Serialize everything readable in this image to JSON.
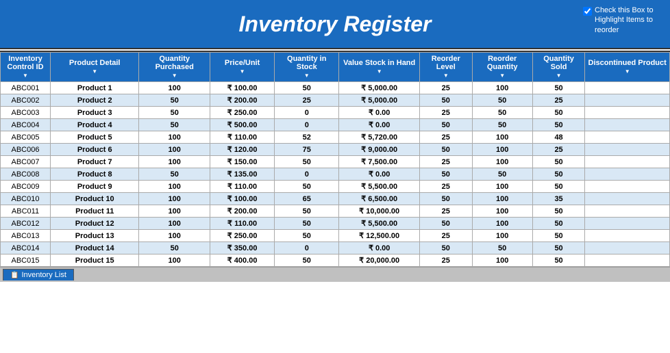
{
  "header": {
    "title": "Inventory Register",
    "checkbox_label": "Check this Box to Highlight Items to reorder",
    "checkbox_checked": true
  },
  "columns": [
    {
      "id": "inv-control-id",
      "label": "Inventory Control ID",
      "class": "col-id"
    },
    {
      "id": "product-detail",
      "label": "Product Detail",
      "class": "col-product"
    },
    {
      "id": "qty-purchased",
      "label": "Quantity Purchased",
      "class": "col-qty-purchased"
    },
    {
      "id": "price-unit",
      "label": "Price/Unit",
      "class": "col-price"
    },
    {
      "id": "qty-stock",
      "label": "Quantity in Stock",
      "class": "col-qty-stock"
    },
    {
      "id": "value-stock",
      "label": "Value Stock in Hand",
      "class": "col-value-stock"
    },
    {
      "id": "reorder-level",
      "label": "Reorder Level",
      "class": "col-reorder-level"
    },
    {
      "id": "reorder-qty",
      "label": "Reorder Quantity",
      "class": "col-reorder-qty"
    },
    {
      "id": "qty-sold",
      "label": "Quantity Sold",
      "class": "col-qty-sold"
    },
    {
      "id": "discontinued",
      "label": "Discontinued Product",
      "class": "col-discontinued"
    }
  ],
  "rows": [
    {
      "id": "ABC001",
      "product": "Product 1",
      "qty_purchased": 100,
      "price": "₹ 100.00",
      "qty_stock": 50,
      "value_stock": "₹ 5,000.00",
      "reorder_level": 25,
      "reorder_qty": 100,
      "qty_sold": 50,
      "discontinued": ""
    },
    {
      "id": "ABC002",
      "product": "Product 2",
      "qty_purchased": 50,
      "price": "₹ 200.00",
      "qty_stock": 25,
      "value_stock": "₹ 5,000.00",
      "reorder_level": 50,
      "reorder_qty": 50,
      "qty_sold": 25,
      "discontinued": ""
    },
    {
      "id": "ABC003",
      "product": "Product 3",
      "qty_purchased": 50,
      "price": "₹ 250.00",
      "qty_stock": 0,
      "value_stock": "₹ 0.00",
      "reorder_level": 25,
      "reorder_qty": 50,
      "qty_sold": 50,
      "discontinued": ""
    },
    {
      "id": "ABC004",
      "product": "Product 4",
      "qty_purchased": 50,
      "price": "₹ 500.00",
      "qty_stock": 0,
      "value_stock": "₹ 0.00",
      "reorder_level": 50,
      "reorder_qty": 50,
      "qty_sold": 50,
      "discontinued": ""
    },
    {
      "id": "ABC005",
      "product": "Product 5",
      "qty_purchased": 100,
      "price": "₹ 110.00",
      "qty_stock": 52,
      "value_stock": "₹ 5,720.00",
      "reorder_level": 25,
      "reorder_qty": 100,
      "qty_sold": 48,
      "discontinued": ""
    },
    {
      "id": "ABC006",
      "product": "Product 6",
      "qty_purchased": 100,
      "price": "₹ 120.00",
      "qty_stock": 75,
      "value_stock": "₹ 9,000.00",
      "reorder_level": 50,
      "reorder_qty": 100,
      "qty_sold": 25,
      "discontinued": ""
    },
    {
      "id": "ABC007",
      "product": "Product 7",
      "qty_purchased": 100,
      "price": "₹ 150.00",
      "qty_stock": 50,
      "value_stock": "₹ 7,500.00",
      "reorder_level": 25,
      "reorder_qty": 100,
      "qty_sold": 50,
      "discontinued": ""
    },
    {
      "id": "ABC008",
      "product": "Product 8",
      "qty_purchased": 50,
      "price": "₹ 135.00",
      "qty_stock": 0,
      "value_stock": "₹ 0.00",
      "reorder_level": 50,
      "reorder_qty": 50,
      "qty_sold": 50,
      "discontinued": ""
    },
    {
      "id": "ABC009",
      "product": "Product 9",
      "qty_purchased": 100,
      "price": "₹ 110.00",
      "qty_stock": 50,
      "value_stock": "₹ 5,500.00",
      "reorder_level": 25,
      "reorder_qty": 100,
      "qty_sold": 50,
      "discontinued": ""
    },
    {
      "id": "ABC010",
      "product": "Product 10",
      "qty_purchased": 100,
      "price": "₹ 100.00",
      "qty_stock": 65,
      "value_stock": "₹ 6,500.00",
      "reorder_level": 50,
      "reorder_qty": 100,
      "qty_sold": 35,
      "discontinued": ""
    },
    {
      "id": "ABC011",
      "product": "Product 11",
      "qty_purchased": 100,
      "price": "₹ 200.00",
      "qty_stock": 50,
      "value_stock": "₹ 10,000.00",
      "reorder_level": 25,
      "reorder_qty": 100,
      "qty_sold": 50,
      "discontinued": ""
    },
    {
      "id": "ABC012",
      "product": "Product 12",
      "qty_purchased": 100,
      "price": "₹ 110.00",
      "qty_stock": 50,
      "value_stock": "₹ 5,500.00",
      "reorder_level": 50,
      "reorder_qty": 100,
      "qty_sold": 50,
      "discontinued": ""
    },
    {
      "id": "ABC013",
      "product": "Product 13",
      "qty_purchased": 100,
      "price": "₹ 250.00",
      "qty_stock": 50,
      "value_stock": "₹ 12,500.00",
      "reorder_level": 25,
      "reorder_qty": 100,
      "qty_sold": 50,
      "discontinued": ""
    },
    {
      "id": "ABC014",
      "product": "Product 14",
      "qty_purchased": 50,
      "price": "₹ 350.00",
      "qty_stock": 0,
      "value_stock": "₹ 0.00",
      "reorder_level": 50,
      "reorder_qty": 50,
      "qty_sold": 50,
      "discontinued": ""
    },
    {
      "id": "ABC015",
      "product": "Product 15",
      "qty_purchased": 100,
      "price": "₹ 400.00",
      "qty_stock": 50,
      "value_stock": "₹ 20,000.00",
      "reorder_level": 25,
      "reorder_qty": 100,
      "qty_sold": 50,
      "discontinued": ""
    }
  ],
  "tab": {
    "label": "Inventory List"
  }
}
